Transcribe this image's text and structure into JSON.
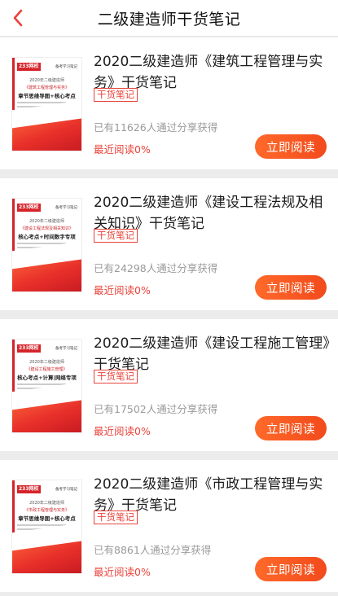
{
  "header": {
    "title": "二级建造师干货笔记"
  },
  "colors": {
    "accent": "#e8433a",
    "button": "#f4541f"
  },
  "cover_common": {
    "logo": "233网校",
    "tag": "备考学习笔记"
  },
  "cards": [
    {
      "title": "2020二级建造师《建筑工程管理与实务》干货笔记",
      "badge": "干货笔记",
      "share_text": "已有11626人通过分享获得",
      "recent": "最近阅读0%",
      "button": "立即阅读",
      "cover_year": "2020年二级建造师",
      "cover_book": "《建筑工程管理与实务》",
      "cover_sub": "章节思维导图+核心考点"
    },
    {
      "title": "2020二级建造师《建设工程法规及相关知识》干货笔记",
      "badge": "干货笔记",
      "share_text": "已有24298人通过分享获得",
      "recent": "最近阅读0%",
      "button": "立即阅读",
      "cover_year": "2020年二级建造师",
      "cover_book": "《建设工程法规及相关知识》",
      "cover_sub": "核心考点+时间数字专项"
    },
    {
      "title": "2020二级建造师《建设工程施工管理》干货笔记",
      "badge": "干货笔记",
      "share_text": "已有17502人通过分享获得",
      "recent": "最近阅读0%",
      "button": "立即阅读",
      "cover_year": "2020年二级建造师",
      "cover_book": "《建设工程施工管理》",
      "cover_sub": "核心考点+计算|网络专项"
    },
    {
      "title": "2020二级建造师《市政工程管理与实务》干货笔记",
      "badge": "干货笔记",
      "share_text": "已有8861人通过分享获得",
      "recent": "最近阅读0%",
      "button": "立即阅读",
      "cover_year": "2020年二级建造师",
      "cover_book": "《市政工程管理与实务》",
      "cover_sub": "章节思维导图+核心考点"
    }
  ]
}
